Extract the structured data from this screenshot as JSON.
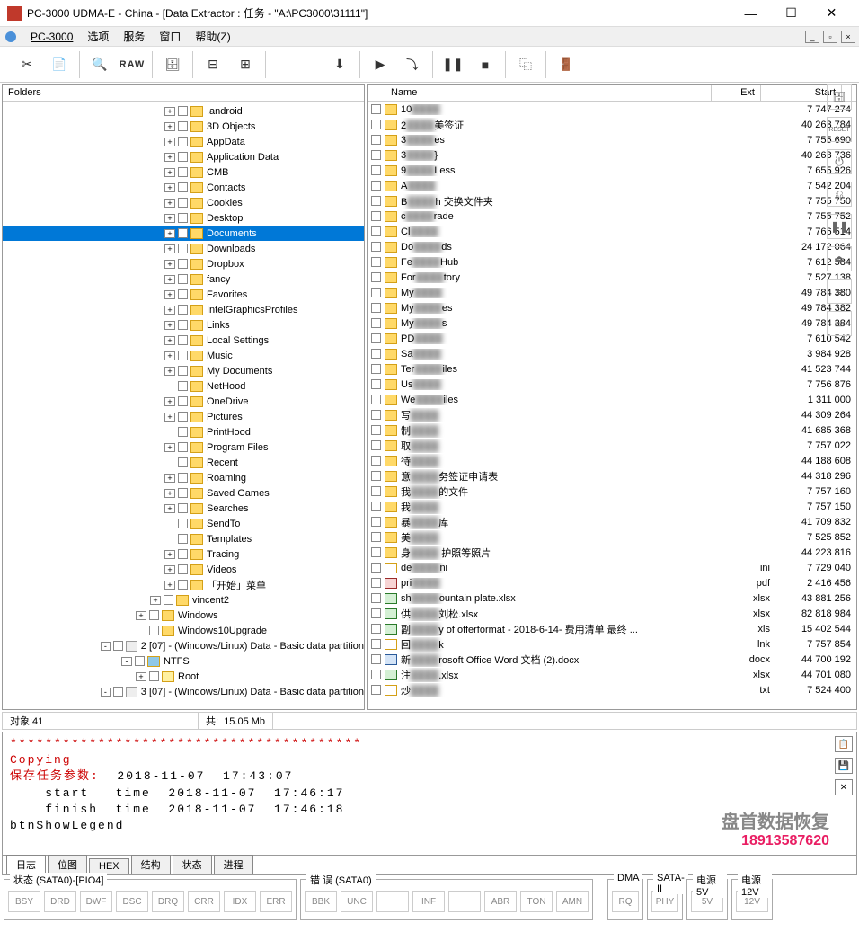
{
  "window": {
    "title": "PC-3000 UDMA-E - China - [Data Extractor : 任务 - \"A:\\PC3000\\31111\"]"
  },
  "menu": {
    "pc3000": "PC-3000",
    "options": "选项",
    "service": "服务",
    "window": "窗口",
    "help": "帮助(Z)"
  },
  "toolbar": {
    "raw": "RAW"
  },
  "left_panel": {
    "header": "Folders"
  },
  "tree": [
    {
      "indent": 180,
      "exp": "+",
      "name": ".android"
    },
    {
      "indent": 180,
      "exp": "+",
      "name": "3D Objects"
    },
    {
      "indent": 180,
      "exp": "+",
      "name": "AppData"
    },
    {
      "indent": 180,
      "exp": "+",
      "name": "Application Data"
    },
    {
      "indent": 180,
      "exp": "+",
      "name": "CMB"
    },
    {
      "indent": 180,
      "exp": "+",
      "name": "Contacts"
    },
    {
      "indent": 180,
      "exp": "+",
      "name": "Cookies"
    },
    {
      "indent": 180,
      "exp": "+",
      "name": "Desktop"
    },
    {
      "indent": 180,
      "exp": "+",
      "name": "Documents",
      "selected": true
    },
    {
      "indent": 180,
      "exp": "+",
      "name": "Downloads"
    },
    {
      "indent": 180,
      "exp": "+",
      "name": "Dropbox"
    },
    {
      "indent": 180,
      "exp": "+",
      "name": "fancy"
    },
    {
      "indent": 180,
      "exp": "+",
      "name": "Favorites"
    },
    {
      "indent": 180,
      "exp": "+",
      "name": "IntelGraphicsProfiles"
    },
    {
      "indent": 180,
      "exp": "+",
      "name": "Links"
    },
    {
      "indent": 180,
      "exp": "+",
      "name": "Local Settings"
    },
    {
      "indent": 180,
      "exp": "+",
      "name": "Music"
    },
    {
      "indent": 180,
      "exp": "+",
      "name": "My Documents"
    },
    {
      "indent": 180,
      "exp": " ",
      "name": "NetHood"
    },
    {
      "indent": 180,
      "exp": "+",
      "name": "OneDrive"
    },
    {
      "indent": 180,
      "exp": "+",
      "name": "Pictures"
    },
    {
      "indent": 180,
      "exp": " ",
      "name": "PrintHood"
    },
    {
      "indent": 180,
      "exp": "+",
      "name": "Program Files"
    },
    {
      "indent": 180,
      "exp": " ",
      "name": "Recent"
    },
    {
      "indent": 180,
      "exp": "+",
      "name": "Roaming"
    },
    {
      "indent": 180,
      "exp": "+",
      "name": "Saved Games"
    },
    {
      "indent": 180,
      "exp": "+",
      "name": "Searches"
    },
    {
      "indent": 180,
      "exp": " ",
      "name": "SendTo"
    },
    {
      "indent": 180,
      "exp": " ",
      "name": "Templates"
    },
    {
      "indent": 180,
      "exp": "+",
      "name": "Tracing"
    },
    {
      "indent": 180,
      "exp": "+",
      "name": "Videos"
    },
    {
      "indent": 180,
      "exp": "+",
      "name": "「开始」菜单"
    },
    {
      "indent": 164,
      "exp": "+",
      "name": "vincent2"
    },
    {
      "indent": 148,
      "exp": "+",
      "name": "Windows"
    },
    {
      "indent": 148,
      "exp": " ",
      "name": "Windows10Upgrade"
    },
    {
      "indent": 116,
      "exp": "-",
      "name": "2 [07] - (Windows/Linux) Data - Basic data partition",
      "disk": true
    },
    {
      "indent": 132,
      "exp": "-",
      "name": "NTFS",
      "special": true
    },
    {
      "indent": 148,
      "exp": "+",
      "name": "Root",
      "root": true
    },
    {
      "indent": 116,
      "exp": "-",
      "name": "3 [07] - (Windows/Linux) Data - Basic data partition",
      "disk": true
    }
  ],
  "list_header": {
    "name": "Name",
    "ext": "Ext",
    "start": "Start"
  },
  "files": [
    {
      "name_a": "10",
      "name_b": "",
      "ext": "",
      "start": "7 747 274",
      "type": "folder"
    },
    {
      "name_a": "2",
      "name_b": "美签证",
      "ext": "",
      "start": "40 263 784",
      "type": "folder"
    },
    {
      "name_a": "3",
      "name_b": "es",
      "ext": "",
      "start": "7 755 690",
      "type": "folder"
    },
    {
      "name_a": "3",
      "name_b": "}",
      "ext": "",
      "start": "40 263 736",
      "type": "folder"
    },
    {
      "name_a": "9",
      "name_b": "Less",
      "ext": "",
      "start": "7 655 926",
      "type": "folder"
    },
    {
      "name_a": "A",
      "name_b": "",
      "ext": "",
      "start": "7 542 204",
      "type": "folder"
    },
    {
      "name_a": "B",
      "name_b": "h 交换文件夹",
      "ext": "",
      "start": "7 755 750",
      "type": "folder"
    },
    {
      "name_a": "c",
      "name_b": "rade",
      "ext": "",
      "start": "7 755 752",
      "type": "folder"
    },
    {
      "name_a": "Cl",
      "name_b": "",
      "ext": "",
      "start": "7 766 514",
      "type": "folder"
    },
    {
      "name_a": "Do",
      "name_b": "ds",
      "ext": "",
      "start": "24 172 064",
      "type": "folder"
    },
    {
      "name_a": "Fe",
      "name_b": "Hub",
      "ext": "",
      "start": "7 612 584",
      "type": "folder"
    },
    {
      "name_a": "For",
      "name_b": "tory",
      "ext": "",
      "start": "7 527 138",
      "type": "folder"
    },
    {
      "name_a": "My",
      "name_b": "",
      "ext": "",
      "start": "49 784 380",
      "type": "folder"
    },
    {
      "name_a": "My",
      "name_b": "es",
      "ext": "",
      "start": "49 784 382",
      "type": "folder"
    },
    {
      "name_a": "My",
      "name_b": "s",
      "ext": "",
      "start": "49 784 384",
      "type": "folder"
    },
    {
      "name_a": "PD",
      "name_b": "",
      "ext": "",
      "start": "7 610 542",
      "type": "folder"
    },
    {
      "name_a": "Sa",
      "name_b": "",
      "ext": "",
      "start": "3 984 928",
      "type": "folder"
    },
    {
      "name_a": "Ter",
      "name_b": "iles",
      "ext": "",
      "start": "41 523 744",
      "type": "folder"
    },
    {
      "name_a": "Us",
      "name_b": "",
      "ext": "",
      "start": "7 756 876",
      "type": "folder"
    },
    {
      "name_a": "We",
      "name_b": "iles",
      "ext": "",
      "start": "1 311 000",
      "type": "folder"
    },
    {
      "name_a": "写",
      "name_b": "",
      "ext": "",
      "start": "44 309 264",
      "type": "folder"
    },
    {
      "name_a": "制",
      "name_b": "",
      "ext": "",
      "start": "41 685 368",
      "type": "folder"
    },
    {
      "name_a": "取",
      "name_b": "",
      "ext": "",
      "start": "7 757 022",
      "type": "folder"
    },
    {
      "name_a": "待",
      "name_b": "",
      "ext": "",
      "start": "44 188 608",
      "type": "folder"
    },
    {
      "name_a": "意",
      "name_b": "务签证申请表",
      "ext": "",
      "start": "44 318 296",
      "type": "folder"
    },
    {
      "name_a": "我",
      "name_b": "的文件",
      "ext": "",
      "start": "7 757 160",
      "type": "folder"
    },
    {
      "name_a": "我",
      "name_b": "",
      "ext": "",
      "start": "7 757 150",
      "type": "folder"
    },
    {
      "name_a": "暴",
      "name_b": "库",
      "ext": "",
      "start": "41 709 832",
      "type": "folder"
    },
    {
      "name_a": "美",
      "name_b": "",
      "ext": "",
      "start": "7 525 852",
      "type": "folder"
    },
    {
      "name_a": "身",
      "name_b": " 护照等照片",
      "ext": "",
      "start": "44 223 816",
      "type": "folder"
    },
    {
      "name_a": "de",
      "name_b": "ni",
      "ext": "ini",
      "start": "7 729 040",
      "type": "file"
    },
    {
      "name_a": "pri",
      "name_b": "",
      "ext": "pdf",
      "start": "2 416 456",
      "type": "pdf"
    },
    {
      "name_a": "sh",
      "name_b": "ountain plate.xlsx",
      "ext": "xlsx",
      "start": "43 881 256",
      "type": "xls"
    },
    {
      "name_a": "供",
      "name_b": "刘松.xlsx",
      "ext": "xlsx",
      "start": "82 818 984",
      "type": "xls"
    },
    {
      "name_a": "副",
      "name_b": "y of offerformat - 2018-6-14- 费用清单 最终 ...",
      "ext": "xls",
      "start": "15 402 544",
      "type": "xls"
    },
    {
      "name_a": "回",
      "name_b": "k",
      "ext": "lnk",
      "start": "7 757 854",
      "type": "file"
    },
    {
      "name_a": "新",
      "name_b": "rosoft Office Word 文档 (2).docx",
      "ext": "docx",
      "start": "44 700 192",
      "type": "doc"
    },
    {
      "name_a": "注",
      "name_b": ".xlsx",
      "ext": "xlsx",
      "start": "44 701 080",
      "type": "xls"
    },
    {
      "name_a": "炒",
      "name_b": "",
      "ext": "txt",
      "start": "7 524 400",
      "type": "file"
    }
  ],
  "status": {
    "objects": "对象:41",
    "total_label": "共:",
    "total_value": "15.05 Mb"
  },
  "log": {
    "stars": "****************************************",
    "l1": "Copying",
    "l2_a": "保存任务参数:",
    "l2_b": "  2018-11-07  17:43:07",
    "l3": "    start   time  2018-11-07  17:46:17",
    "l4": "    finish  time  2018-11-07  17:46:18",
    "l5": "btnShowLegend"
  },
  "watermark": {
    "line1": "盘首数据恢复",
    "line2": "18913587620"
  },
  "log_tabs": [
    "日志",
    "位图",
    "HEX",
    "结构",
    "状态",
    "进程"
  ],
  "bottom": {
    "g1_title": "状态 (SATA0)-[PIO4]",
    "g1": [
      "BSY",
      "DRD",
      "DWF",
      "DSC",
      "DRQ",
      "CRR",
      "IDX",
      "ERR"
    ],
    "g2_title": "错 误 (SATA0)",
    "g2": [
      "BBK",
      "UNC",
      "",
      "INF",
      "",
      "ABR",
      "TON",
      "AMN"
    ],
    "g3_title": "DMA",
    "g3": [
      "RQ"
    ],
    "g4_title": "SATA-II",
    "g4": [
      "PHY"
    ],
    "g5_title": "电源 5V",
    "g5": [
      "5V"
    ],
    "g6_title": "电源 12V",
    "g6": [
      "12V"
    ]
  }
}
